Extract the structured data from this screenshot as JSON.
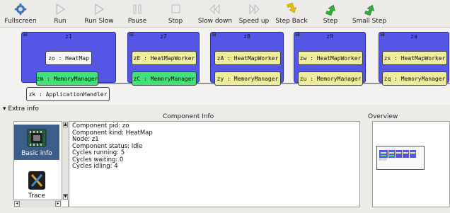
{
  "toolbar": {
    "buttons": [
      {
        "label": "Fullscreen",
        "icon": "fullscreen-icon"
      },
      {
        "label": "Run",
        "icon": "play-icon"
      },
      {
        "label": "Run Slow",
        "icon": "play-slow-icon"
      },
      {
        "label": "Pause",
        "icon": "pause-icon"
      },
      {
        "label": "Stop",
        "icon": "stop-icon"
      },
      {
        "label": "Slow down",
        "icon": "rewind-icon"
      },
      {
        "label": "Speed up",
        "icon": "fast-forward-icon"
      },
      {
        "label": "Step Back",
        "icon": "step-back-icon"
      },
      {
        "label": "Step",
        "icon": "step-icon"
      },
      {
        "label": "Small Step",
        "icon": "small-step-icon"
      }
    ]
  },
  "canvas": {
    "nodes": [
      {
        "id": "z1",
        "components": [
          "zo : HeatMap",
          "zm : MemoryManager",
          "zk : ApplicationHandler"
        ]
      },
      {
        "id": "z7",
        "components": [
          "zE : HeatMapWorker",
          "zC : MemoryManager"
        ]
      },
      {
        "id": "z8",
        "components": [
          "zA : HeatMapWorker",
          "zy : MemoryManager"
        ]
      },
      {
        "id": "z9",
        "components": [
          "zw : HeatMapWorker",
          "zu : MemoryManager"
        ]
      },
      {
        "id": "za",
        "components": [
          "zs : HeatMapWorker",
          "zq : MemoryManager"
        ]
      }
    ]
  },
  "extra_info": {
    "header": "Extra info",
    "component_info_title": "Component Info",
    "overview_title": "Overview",
    "sidebar": [
      {
        "label": "Basic info",
        "icon": "basic-info-icon",
        "selected": true
      },
      {
        "label": "Trace",
        "icon": "trace-icon",
        "selected": false
      }
    ],
    "info_lines": [
      "Component pid: zo",
      "Component kind: HeatMap",
      "Node: z1",
      "Component status: Idle",
      "Cycles running: 5",
      "Cycles waiting: 0",
      "Cycles idling: 4"
    ]
  },
  "colors": {
    "node_blue": "#5555e6",
    "component_yellow": "#ecec9a",
    "component_green": "#44e07a",
    "selected_sidebar": "#3b5f8a",
    "step_green": "#2fae3a",
    "step_back_yellow": "#e8c000"
  }
}
